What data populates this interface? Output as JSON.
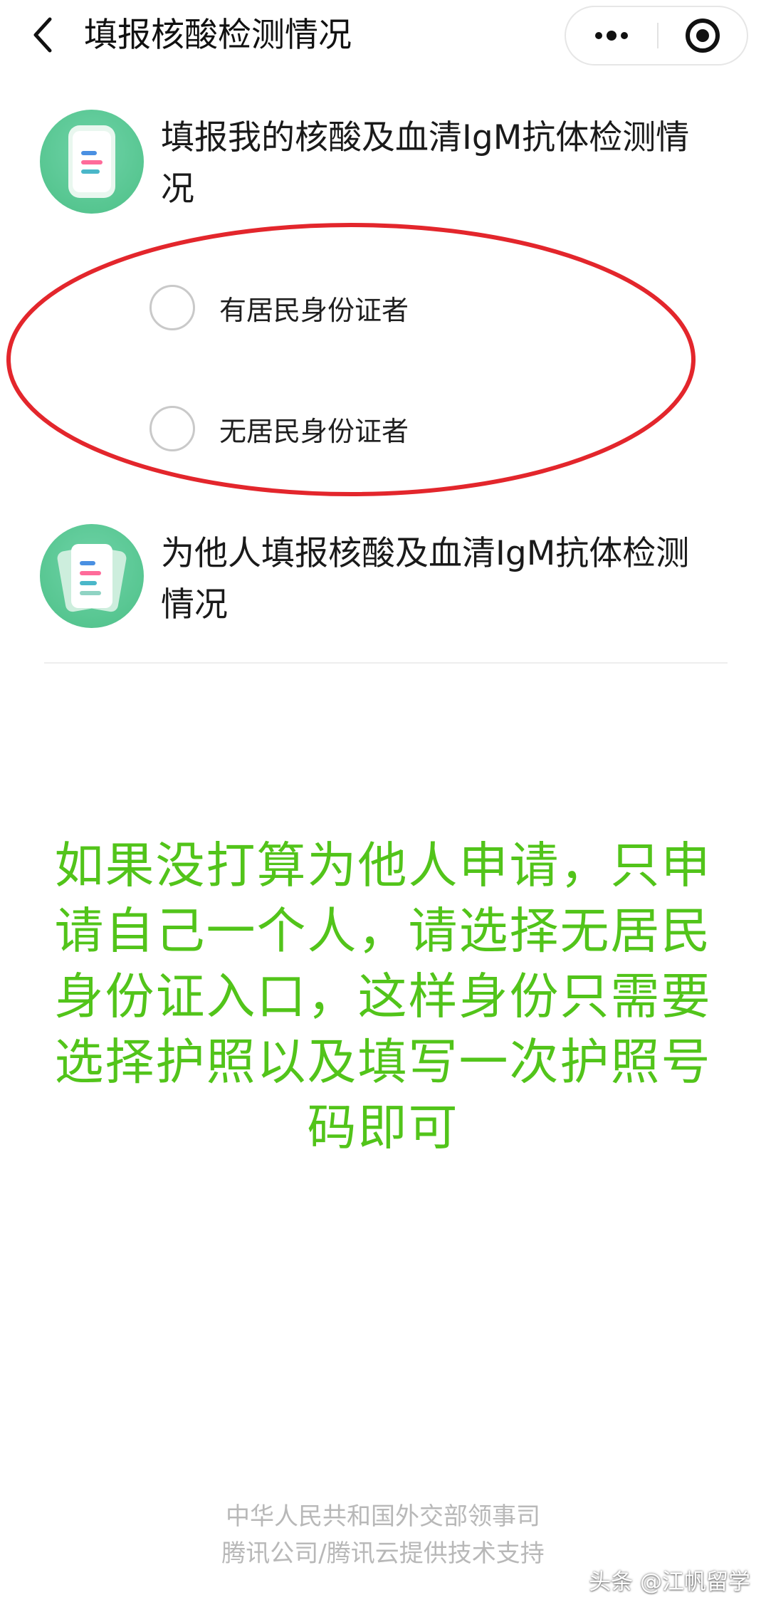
{
  "header": {
    "title": "填报核酸检测情况",
    "back_icon": "chevron-left-icon",
    "more_icon": "more-dots-icon",
    "close_icon": "target-close-icon"
  },
  "options": [
    {
      "title": "填报我的核酸及血清IgM抗体检测情况",
      "icon": "document-icon",
      "sub_options": [
        {
          "label": "有居民身份证者",
          "checked": false
        },
        {
          "label": "无居民身份证者",
          "checked": false
        }
      ]
    },
    {
      "title": "为他人填报核酸及血清IgM抗体检测情况",
      "icon": "documents-stack-icon"
    }
  ],
  "annotation": {
    "note": "如果没打算为他人申请，只申请自己一个人，请选择无居民身份证入口，这样身份只需要选择护照以及填写一次护照号码即可",
    "note_color": "#52c41a",
    "highlight_color": "#e3262c"
  },
  "footer": {
    "line1": "中华人民共和国外交部领事司",
    "line2": "腾讯公司/腾讯云提供技术支持"
  },
  "watermark": "头条 @江帆留学",
  "colors": {
    "icon_green": "#57c691",
    "radio_border": "#c9c9c9",
    "footer_text": "#b8b8b8"
  }
}
